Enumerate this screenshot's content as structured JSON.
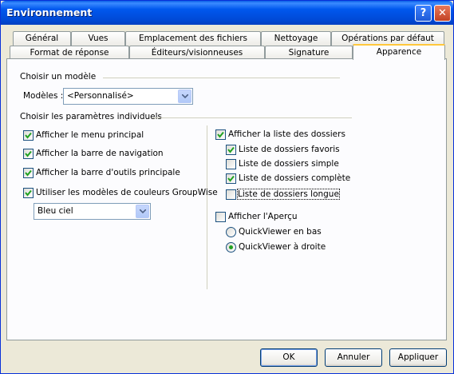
{
  "window": {
    "title": "Environnement",
    "help_glyph": "?",
    "close_glyph": "✕"
  },
  "tabs_row1": [
    {
      "label": "Général"
    },
    {
      "label": "Vues"
    },
    {
      "label": "Emplacement des fichiers"
    },
    {
      "label": "Nettoyage"
    },
    {
      "label": "Opérations par défaut"
    }
  ],
  "tabs_row2": [
    {
      "label": "Format de réponse"
    },
    {
      "label": "Éditeurs/visionneuses"
    },
    {
      "label": "Signature"
    },
    {
      "label": "Apparence",
      "active": true
    }
  ],
  "model_group": {
    "title": "Choisir un modèle",
    "label": "Modèles :",
    "selected": "<Personnalisé>"
  },
  "params_group": {
    "title": "Choisir les paramètres individuels"
  },
  "left_options": [
    {
      "label": "Afficher le menu principal",
      "checked": true
    },
    {
      "label": "Afficher la barre de navigation",
      "checked": true
    },
    {
      "label": "Afficher la barre d'outils principale",
      "checked": true
    },
    {
      "label": "Utiliser les modèles de couleurs GroupWise",
      "checked": true
    }
  ],
  "color_scheme": {
    "selected": "Bleu ciel"
  },
  "folder_list": {
    "label": "Afficher la liste des dossiers",
    "checked": true,
    "options": [
      {
        "label": "Liste de dossiers favoris",
        "checked": true
      },
      {
        "label": "Liste de dossiers simple",
        "checked": false
      },
      {
        "label": "Liste de dossiers complète",
        "checked": true
      },
      {
        "label": "Liste de dossiers longue",
        "checked": false,
        "focused": true
      }
    ]
  },
  "preview": {
    "label": "Afficher l'Aperçu",
    "checked": false,
    "options": [
      {
        "label": "QuickViewer en bas",
        "selected": false
      },
      {
        "label": "QuickViewer à droite",
        "selected": true
      }
    ]
  },
  "buttons": {
    "ok": "OK",
    "cancel": "Annuler",
    "apply": "Appliquer"
  },
  "colors": {
    "title_bar": "#0058ee",
    "dialog_bg": "#ece9d8",
    "active_tab_accent": "#ffc83c",
    "check": "#21a121"
  }
}
